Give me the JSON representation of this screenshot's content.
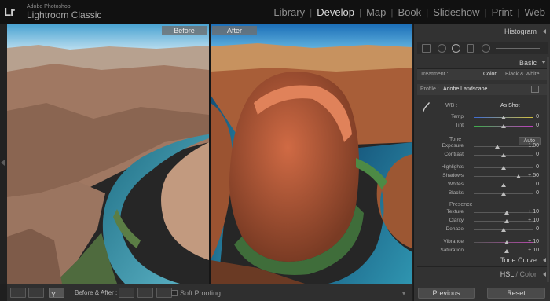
{
  "app": {
    "logo": "Lr",
    "vendor": "Adobe Photoshop",
    "name": "Lightroom Classic"
  },
  "modules": [
    {
      "label": "Library",
      "active": false
    },
    {
      "label": "Develop",
      "active": true
    },
    {
      "label": "Map",
      "active": false
    },
    {
      "label": "Book",
      "active": false
    },
    {
      "label": "Slideshow",
      "active": false
    },
    {
      "label": "Print",
      "active": false
    },
    {
      "label": "Web",
      "active": false
    }
  ],
  "view": {
    "before_label": "Before",
    "after_label": "After"
  },
  "toolbar": {
    "before_after_label": "Before & After :",
    "soft_proofing_label": "Soft Proofing",
    "soft_proofing_checked": false
  },
  "panels": {
    "histogram": "Histogram",
    "basic": "Basic",
    "tone_curve": "Tone Curve",
    "hsl": "HSL",
    "hsl_color": "Color"
  },
  "basic": {
    "treatment_label": "Treatment :",
    "treatment_color": "Color",
    "treatment_bw": "Black & White",
    "profile_label": "Profile :",
    "profile_value": "Adobe Landscape",
    "wb_label": "WB :",
    "wb_value": "As Shot",
    "tone_label": "Tone",
    "auto_label": "Auto",
    "presence_label": "Presence",
    "sliders": [
      {
        "label": "Temp",
        "value": "0",
        "pos": 0.5,
        "group": "wb"
      },
      {
        "label": "Tint",
        "value": "0",
        "pos": 0.5,
        "group": "wb"
      },
      {
        "label": "Exposure",
        "value": "− 1.00",
        "pos": 0.4,
        "group": "tone"
      },
      {
        "label": "Contrast",
        "value": "0",
        "pos": 0.5,
        "group": "tone"
      },
      {
        "label": "Highlights",
        "value": "0",
        "pos": 0.5,
        "group": "tone2"
      },
      {
        "label": "Shadows",
        "value": "+ 50",
        "pos": 0.75,
        "group": "tone2"
      },
      {
        "label": "Whites",
        "value": "0",
        "pos": 0.5,
        "group": "tone2"
      },
      {
        "label": "Blacks",
        "value": "0",
        "pos": 0.5,
        "group": "tone2"
      },
      {
        "label": "Texture",
        "value": "+ 10",
        "pos": 0.55,
        "group": "presence"
      },
      {
        "label": "Clarity",
        "value": "+ 10",
        "pos": 0.55,
        "group": "presence"
      },
      {
        "label": "Dehaze",
        "value": "0",
        "pos": 0.5,
        "group": "presence"
      },
      {
        "label": "Vibrance",
        "value": "+ 10",
        "pos": 0.55,
        "group": "presence2"
      },
      {
        "label": "Saturation",
        "value": "+ 10",
        "pos": 0.55,
        "group": "presence2"
      }
    ]
  },
  "footer": {
    "previous": "Previous",
    "reset": "Reset"
  },
  "colors": {
    "background": "#1f1f1f",
    "panel": "#323232",
    "text": "#bdbdbd"
  }
}
